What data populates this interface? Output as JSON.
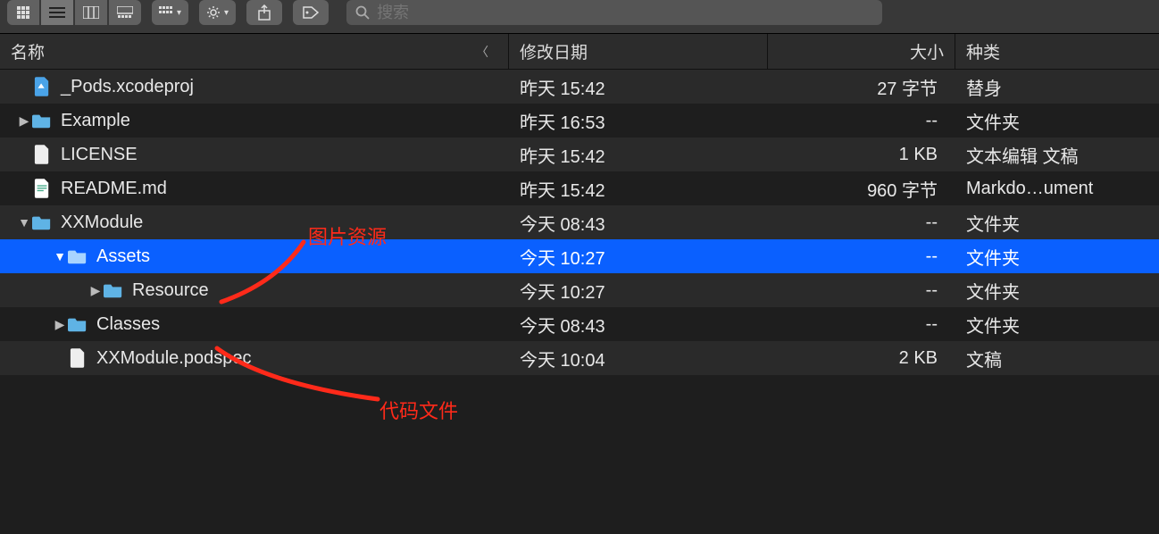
{
  "toolbar": {
    "search_placeholder": "搜索"
  },
  "columns": {
    "name": "名称",
    "date": "修改日期",
    "size": "大小",
    "kind": "种类"
  },
  "rows": [
    {
      "indent": 1,
      "disclosure": "",
      "icon": "xcodeproj",
      "name": "_Pods.xcodeproj",
      "date": "昨天 15:42",
      "size": "27 字节",
      "kind": "替身"
    },
    {
      "indent": 1,
      "disclosure": "▶",
      "icon": "folder",
      "name": "Example",
      "date": "昨天 16:53",
      "size": "--",
      "kind": "文件夹"
    },
    {
      "indent": 1,
      "disclosure": "",
      "icon": "file",
      "name": "LICENSE",
      "date": "昨天 15:42",
      "size": "1 KB",
      "kind": "文本编辑 文稿"
    },
    {
      "indent": 1,
      "disclosure": "",
      "icon": "md",
      "name": "README.md",
      "date": "昨天 15:42",
      "size": "960 字节",
      "kind": "Markdo…ument"
    },
    {
      "indent": 1,
      "disclosure": "▼",
      "icon": "folder",
      "name": "XXModule",
      "date": "今天 08:43",
      "size": "--",
      "kind": "文件夹"
    },
    {
      "indent": 2,
      "disclosure": "▼",
      "icon": "folder",
      "name": "Assets",
      "date": "今天 10:27",
      "size": "--",
      "kind": "文件夹",
      "selected": true
    },
    {
      "indent": 3,
      "disclosure": "▶",
      "icon": "folder",
      "name": "Resource",
      "date": "今天 10:27",
      "size": "--",
      "kind": "文件夹"
    },
    {
      "indent": 2,
      "disclosure": "▶",
      "icon": "folder",
      "name": "Classes",
      "date": "今天 08:43",
      "size": "--",
      "kind": "文件夹"
    },
    {
      "indent": 2,
      "disclosure": "",
      "icon": "file",
      "name": "XXModule.podspec",
      "date": "今天 10:04",
      "size": "2 KB",
      "kind": "文稿"
    }
  ],
  "annotations": {
    "a1": "图片资源",
    "a2": "代码文件"
  }
}
